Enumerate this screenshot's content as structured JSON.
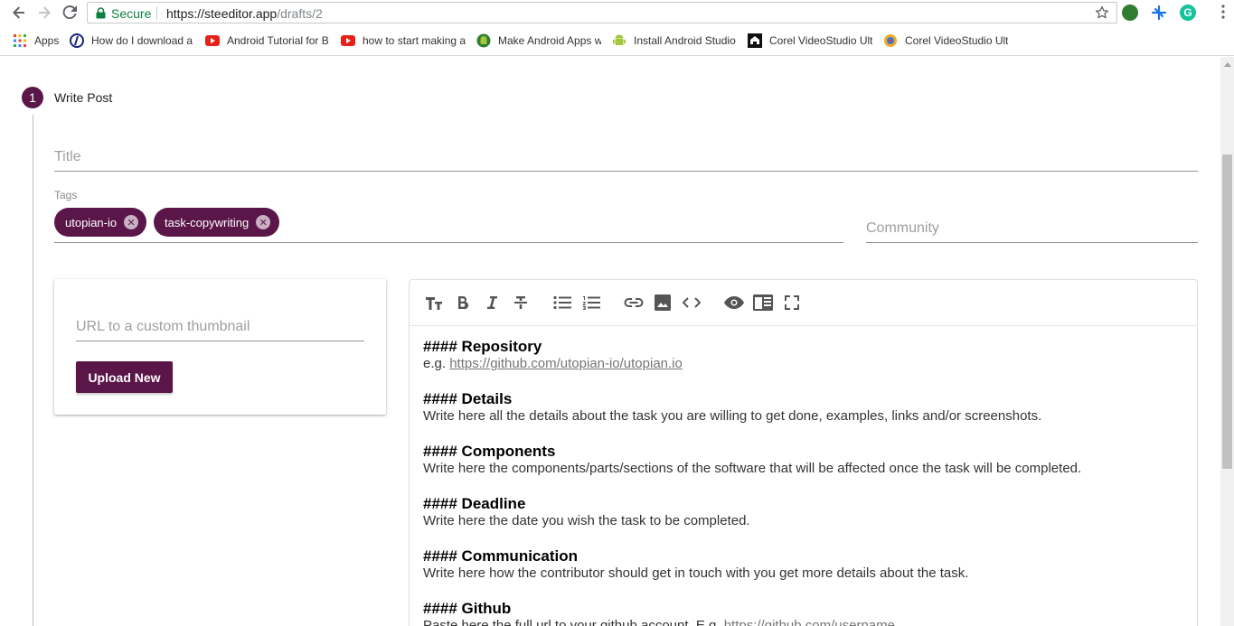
{
  "browser": {
    "secure_label": "Secure",
    "url_host": "https://steeditor.app",
    "url_path": "/drafts/2",
    "icons": [
      "back-icon",
      "forward-icon",
      "reload-icon",
      "lock-icon",
      "star-icon",
      "menu-icon"
    ]
  },
  "bookmarks": [
    {
      "label": "Apps",
      "icon": "apps-grid-icon"
    },
    {
      "label": "How do I download a",
      "icon": "site-icon"
    },
    {
      "label": "Android Tutorial for B",
      "icon": "youtube-icon"
    },
    {
      "label": "how to start making a",
      "icon": "youtube-icon"
    },
    {
      "label": "Make Android Apps w",
      "icon": "android-icon"
    },
    {
      "label": "Install Android Studio",
      "icon": "android-icon"
    },
    {
      "label": "Corel VideoStudio Ult",
      "icon": "site-icon"
    },
    {
      "label": "Corel VideoStudio Ult",
      "icon": "site-icon"
    }
  ],
  "stepper": {
    "number": "1",
    "title": "Write Post"
  },
  "form": {
    "title_placeholder": "Title",
    "tags_label": "Tags",
    "tags": [
      "utopian-io",
      "task-copywriting"
    ],
    "community_placeholder": "Community",
    "thumbnail_placeholder": "URL to a custom thumbnail",
    "upload_label": "Upload New"
  },
  "editor": {
    "toolbar": [
      "heading-icon",
      "bold-icon",
      "italic-icon",
      "strikethrough-icon",
      "bullet-list-icon",
      "numbered-list-icon",
      "link-icon",
      "image-icon",
      "code-icon",
      "preview-icon",
      "side-by-side-icon",
      "fullscreen-icon"
    ],
    "sections": [
      {
        "heading": "#### Repository",
        "text_prefix": "e.g. ",
        "link": "https://github.com/utopian-io/utopian.io",
        "text": ""
      },
      {
        "heading": "#### Details",
        "text_prefix": "",
        "link": "",
        "text": "Write here all the details about the task you are willing to get done, examples, links and/or screenshots."
      },
      {
        "heading": "#### Components",
        "text_prefix": "",
        "link": "",
        "text": "Write here the components/parts/sections of the software that will be affected once the task will be completed."
      },
      {
        "heading": "#### Deadline",
        "text_prefix": "",
        "link": "",
        "text": "Write here the date you wish the task to be completed."
      },
      {
        "heading": "#### Communication",
        "text_prefix": "",
        "link": "",
        "text": "Write here how the contributor should get in touch with you get more details about the task."
      },
      {
        "heading": "#### Github",
        "text_prefix": "Paste here the full url to your github account. E.g. ",
        "link": "https://github.com/username",
        "text": ""
      }
    ]
  },
  "colors": {
    "accent": "#5a1648",
    "secure_green": "#0b8043"
  }
}
